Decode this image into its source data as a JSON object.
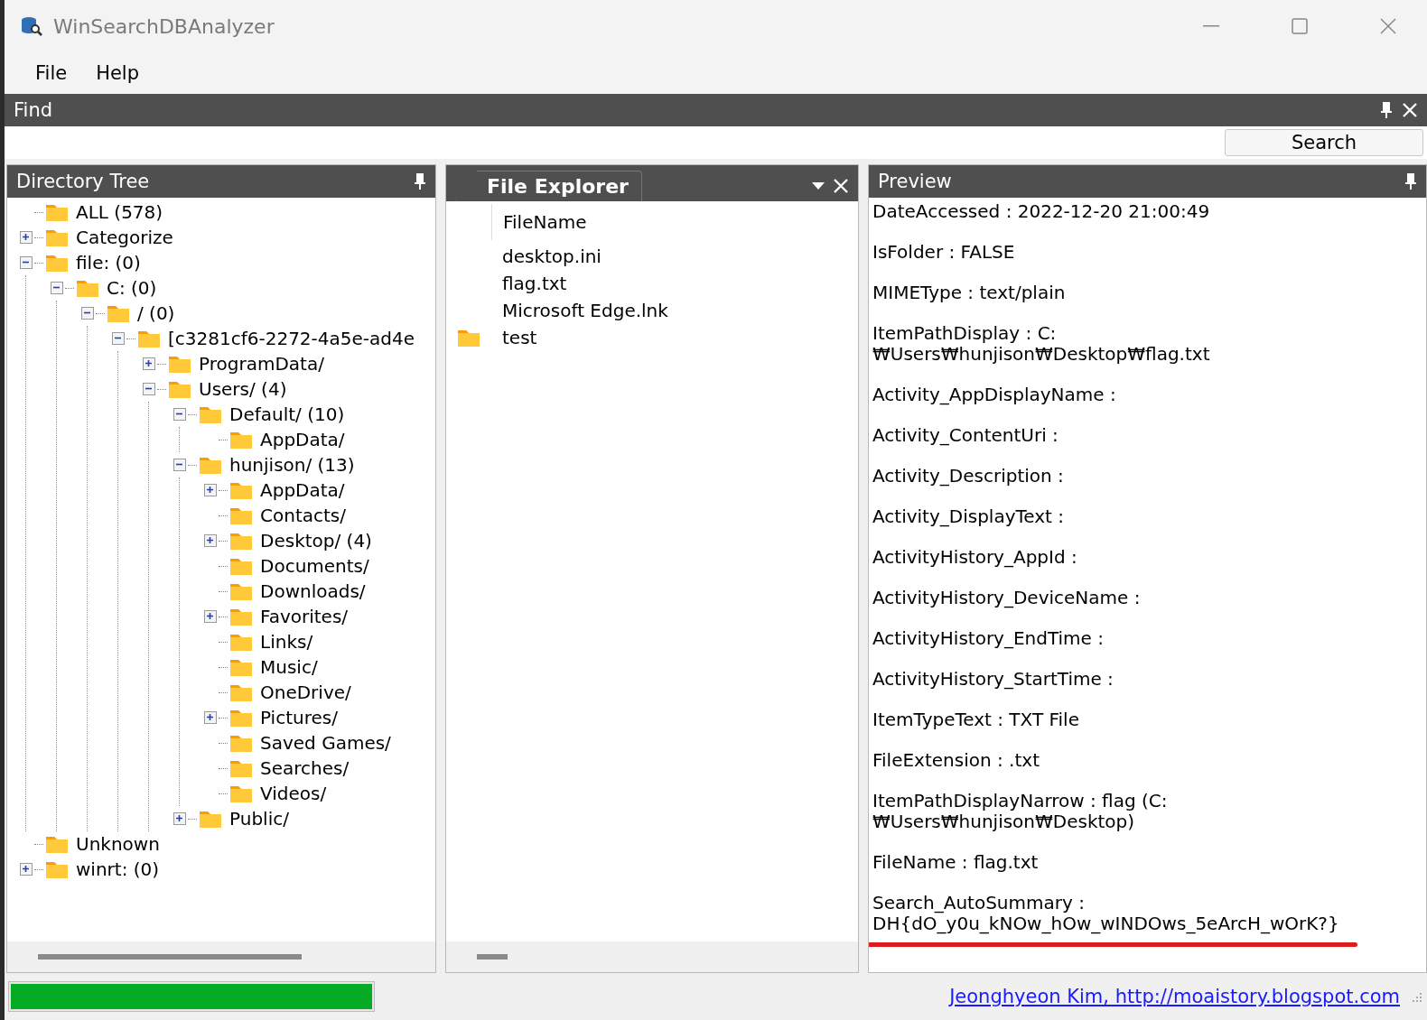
{
  "window": {
    "title": "WinSearchDBAnalyzer"
  },
  "menu": [
    "File",
    "Help"
  ],
  "find": {
    "title": "Find",
    "search_button": "Search"
  },
  "directory_tree": {
    "title": "Directory Tree",
    "items": [
      {
        "label": "ALL (578)",
        "kind": "leaf"
      },
      {
        "label": "Categorize",
        "kind": "branch",
        "expanded": false
      },
      {
        "label": "file: (0)",
        "kind": "branch",
        "expanded": true,
        "children": [
          {
            "label": "C: (0)",
            "kind": "branch",
            "expanded": true,
            "children": [
              {
                "label": "/ (0)",
                "kind": "branch",
                "expanded": true,
                "children": [
                  {
                    "label": "[c3281cf6-2272-4a5e-ad4e",
                    "kind": "branch",
                    "expanded": true,
                    "children": [
                      {
                        "label": "ProgramData/",
                        "kind": "branch",
                        "expanded": false
                      },
                      {
                        "label": "Users/ (4)",
                        "kind": "branch",
                        "expanded": true,
                        "children": [
                          {
                            "label": "Default/ (10)",
                            "kind": "branch",
                            "expanded": true,
                            "children": [
                              {
                                "label": "AppData/",
                                "kind": "leaf"
                              }
                            ]
                          },
                          {
                            "label": "hunjison/ (13)",
                            "kind": "branch",
                            "expanded": true,
                            "children": [
                              {
                                "label": "AppData/",
                                "kind": "branch",
                                "expanded": false
                              },
                              {
                                "label": "Contacts/",
                                "kind": "leaf"
                              },
                              {
                                "label": "Desktop/ (4)",
                                "kind": "branch",
                                "expanded": false
                              },
                              {
                                "label": "Documents/",
                                "kind": "leaf"
                              },
                              {
                                "label": "Downloads/",
                                "kind": "leaf"
                              },
                              {
                                "label": "Favorites/",
                                "kind": "branch",
                                "expanded": false
                              },
                              {
                                "label": "Links/",
                                "kind": "leaf"
                              },
                              {
                                "label": "Music/",
                                "kind": "leaf"
                              },
                              {
                                "label": "OneDrive/",
                                "kind": "leaf"
                              },
                              {
                                "label": "Pictures/",
                                "kind": "branch",
                                "expanded": false
                              },
                              {
                                "label": "Saved Games/",
                                "kind": "leaf"
                              },
                              {
                                "label": "Searches/",
                                "kind": "leaf"
                              },
                              {
                                "label": "Videos/",
                                "kind": "leaf"
                              }
                            ]
                          },
                          {
                            "label": "Public/",
                            "kind": "branch",
                            "expanded": false
                          }
                        ]
                      }
                    ]
                  }
                ]
              }
            ]
          }
        ]
      },
      {
        "label": "Unknown",
        "kind": "leaf"
      },
      {
        "label": "winrt: (0)",
        "kind": "branch",
        "expanded": false
      }
    ]
  },
  "file_explorer": {
    "title": "File Explorer",
    "column": "FileName",
    "files": [
      {
        "name": "desktop.ini",
        "kind": "file"
      },
      {
        "name": "flag.txt",
        "kind": "file"
      },
      {
        "name": "Microsoft Edge.lnk",
        "kind": "file"
      },
      {
        "name": "test",
        "kind": "folder"
      }
    ]
  },
  "preview": {
    "title": "Preview",
    "entries": [
      {
        "text": "DateAccessed : 2022-12-20 21:00:49",
        "underlined": false
      },
      {
        "text": "IsFolder : FALSE",
        "underlined": false
      },
      {
        "text": "MIMEType : text/plain",
        "underlined": false
      },
      {
        "text": "ItemPathDisplay : C:₩Users₩hunjison₩Desktop₩flag.txt",
        "underlined": false
      },
      {
        "text": "Activity_AppDisplayName :",
        "underlined": false
      },
      {
        "text": "Activity_ContentUri :",
        "underlined": false
      },
      {
        "text": "Activity_Description :",
        "underlined": false
      },
      {
        "text": "Activity_DisplayText :",
        "underlined": false
      },
      {
        "text": "ActivityHistory_AppId :",
        "underlined": false
      },
      {
        "text": "ActivityHistory_DeviceName :",
        "underlined": false
      },
      {
        "text": "ActivityHistory_EndTime :",
        "underlined": false
      },
      {
        "text": "ActivityHistory_StartTime :",
        "underlined": false
      },
      {
        "text": "ItemTypeText : TXT File",
        "underlined": false
      },
      {
        "text": "FileExtension : .txt",
        "underlined": false
      },
      {
        "text": "ItemPathDisplayNarrow : flag (C:₩Users₩hunjison₩Desktop)",
        "underlined": false
      },
      {
        "text": "FileName : flag.txt",
        "underlined": false
      },
      {
        "text": "Search_AutoSummary : DH{dO_y0u_kNOw_hOw_wINDOws_5eArcH_wOrK?}",
        "underlined": true
      }
    ]
  },
  "status_bar": {
    "progress": {
      "level": 1
    },
    "link": "Jeonghyeon Kim, http://moaistory.blogspot.com"
  }
}
